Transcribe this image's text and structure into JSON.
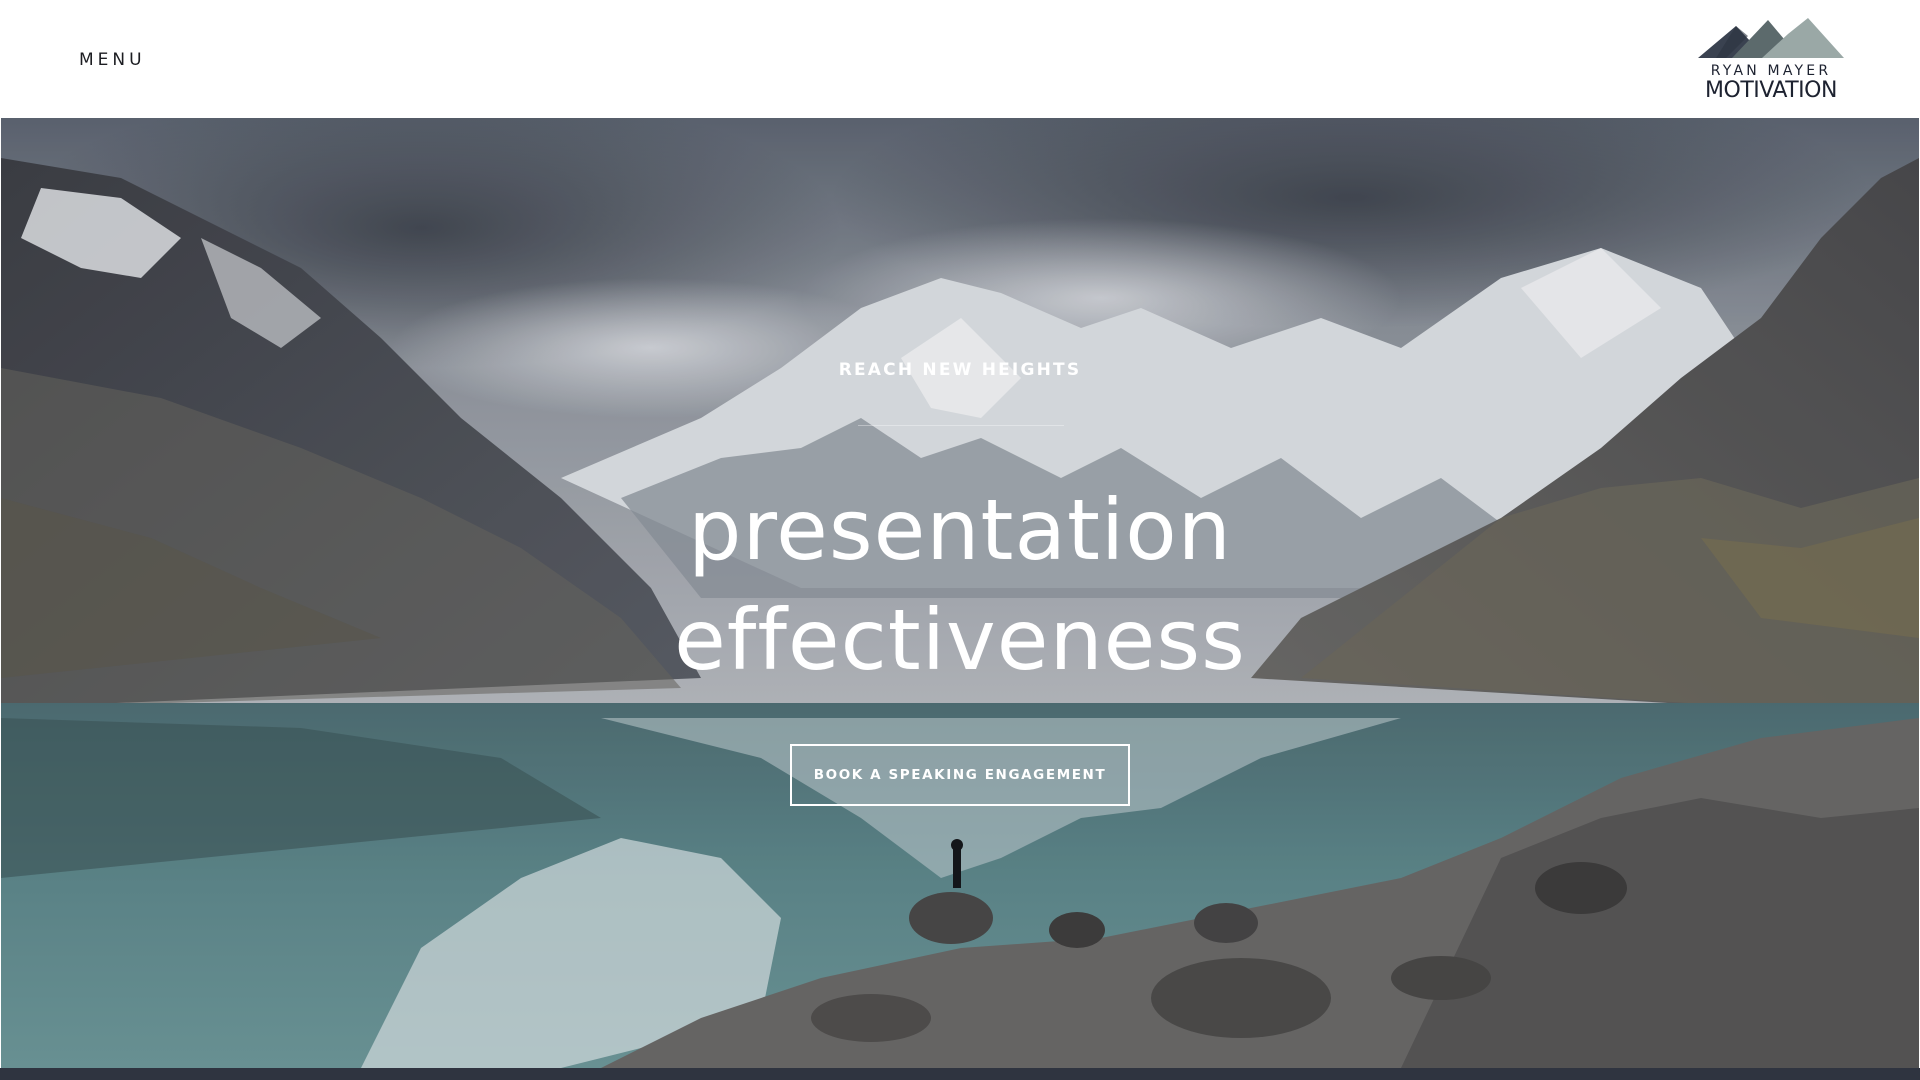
{
  "header": {
    "menu_label": "MENU",
    "logo": {
      "line1": "RYAN MAYER",
      "line2": "MOTIVATION",
      "icon": "mountain-peaks-icon"
    }
  },
  "hero": {
    "eyebrow": "REACH NEW HEIGHTS",
    "headline_line1": "presentation",
    "headline_line2": "effectiveness",
    "cta_label": "BOOK A SPEAKING ENGAGEMENT",
    "background": "mountain-lake-photo"
  },
  "colors": {
    "header_bg": "#ffffff",
    "text_dark": "#1c1d22",
    "hero_text": "#ffffff",
    "bottom_bar": "#2f3440",
    "logo_peak_dark": "#3a4250",
    "logo_peak_mid": "#5c6a6c",
    "logo_peak_light": "#9aa8a6"
  }
}
